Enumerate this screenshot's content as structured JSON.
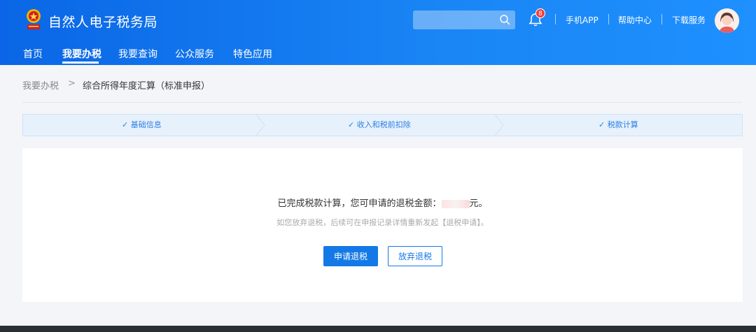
{
  "header": {
    "site_title": "自然人电子税务局",
    "search": {
      "placeholder": ""
    },
    "notification_count": "8",
    "links": [
      "手机APP",
      "帮助中心",
      "下载服务"
    ]
  },
  "nav": {
    "items": [
      "首页",
      "我要办税",
      "我要查询",
      "公众服务",
      "特色应用"
    ],
    "active": "我要办税"
  },
  "breadcrumb": {
    "parent": "我要办税",
    "separator": ">",
    "current": "综合所得年度汇算（标准申报）"
  },
  "steps": [
    {
      "label": "✓ 基础信息"
    },
    {
      "label": "✓ 收入和税前扣除"
    },
    {
      "label": "✓ 税款计算"
    }
  ],
  "result": {
    "message_prefix": "已完成税款计算，您可申请的退税金额：",
    "message_suffix": "元。",
    "sub_message": "如您放弃退税，后续可在申报记录详情重新发起【退税申请】。"
  },
  "buttons": {
    "apply": "申请退税",
    "abandon": "放弃退税"
  },
  "colors": {
    "header_blue": "#0a66e6",
    "primary": "#1479e6",
    "badge_red": "#f23b3b"
  }
}
